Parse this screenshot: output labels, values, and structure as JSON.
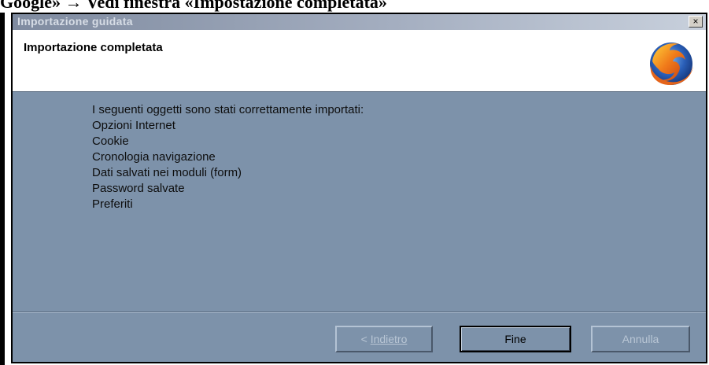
{
  "caption": "Google» → Vedi finestra «Impostazione completata»",
  "window": {
    "title": "Importazione guidata",
    "close_glyph": "×",
    "header_title": "Importazione completata",
    "logo_icon": "firefox-logo"
  },
  "content": {
    "intro": "I seguenti oggetti sono stati correttamente importati:",
    "items": [
      "Opzioni Internet",
      "Cookie",
      "Cronologia navigazione",
      "Dati salvati nei moduli (form)",
      "Password salvate",
      "Preferiti"
    ]
  },
  "buttons": {
    "back_prefix": "< ",
    "back_label": "Indietro",
    "finish_label": "Fine",
    "cancel_label": "Annulla"
  },
  "colors": {
    "window_bg": "#7d92aa",
    "header_bg": "#ffffff",
    "disabled_text": "#b9c6d5"
  }
}
